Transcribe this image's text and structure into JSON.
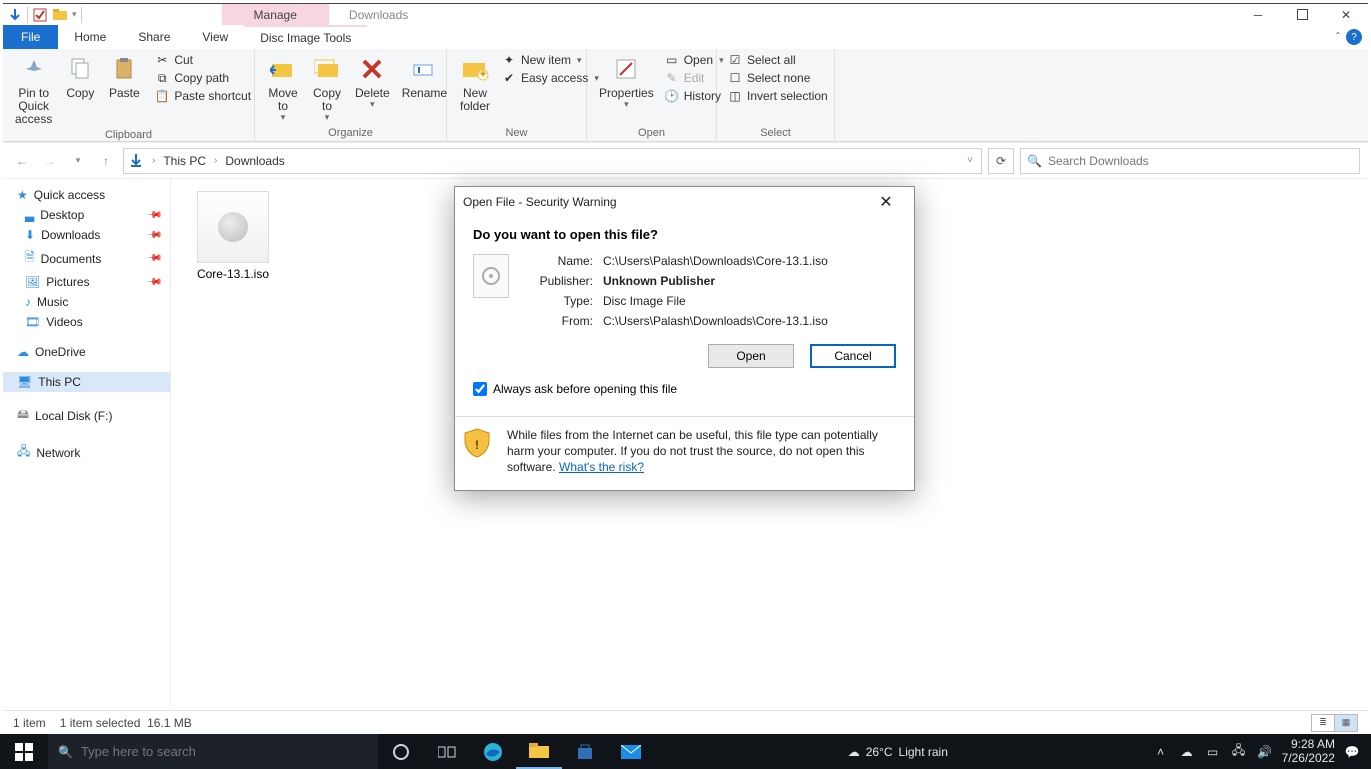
{
  "window": {
    "context_tab": "Manage",
    "title": "Downloads",
    "tabs": {
      "file": "File",
      "home": "Home",
      "share": "Share",
      "view": "View",
      "disc": "Disc Image Tools"
    }
  },
  "ribbon": {
    "clipboard": {
      "label": "Clipboard",
      "pin": "Pin to Quick access",
      "copy": "Copy",
      "paste": "Paste",
      "cut": "Cut",
      "copypath": "Copy path",
      "pasteshortcut": "Paste shortcut"
    },
    "organize": {
      "label": "Organize",
      "moveto": "Move to",
      "copyto": "Copy to",
      "delete": "Delete",
      "rename": "Rename"
    },
    "new": {
      "label": "New",
      "newfolder": "New folder",
      "newitem": "New item",
      "easyaccess": "Easy access"
    },
    "open": {
      "label": "Open",
      "properties": "Properties",
      "open": "Open",
      "edit": "Edit",
      "history": "History"
    },
    "select": {
      "label": "Select",
      "selectall": "Select all",
      "selectnone": "Select none",
      "invert": "Invert selection"
    }
  },
  "breadcrumb": {
    "seg1": "This PC",
    "seg2": "Downloads"
  },
  "search": {
    "placeholder": "Search Downloads"
  },
  "nav": {
    "quick": "Quick access",
    "desktop": "Desktop",
    "downloads": "Downloads",
    "documents": "Documents",
    "pictures": "Pictures",
    "music": "Music",
    "videos": "Videos",
    "onedrive": "OneDrive",
    "thispc": "This PC",
    "localdisk": "Local Disk (F:)",
    "network": "Network"
  },
  "files": {
    "item0": "Core-13.1.iso"
  },
  "status": {
    "count": "1 item",
    "selected": "1 item selected",
    "size": "16.1 MB"
  },
  "dialog": {
    "title": "Open File - Security Warning",
    "question": "Do you want to open this file?",
    "labels": {
      "name": "Name:",
      "publisher": "Publisher:",
      "type": "Type:",
      "from": "From:"
    },
    "values": {
      "name": "C:\\Users\\Palash\\Downloads\\Core-13.1.iso",
      "publisher": "Unknown Publisher",
      "type": "Disc Image File",
      "from": "C:\\Users\\Palash\\Downloads\\Core-13.1.iso"
    },
    "open": "Open",
    "cancel": "Cancel",
    "always": "Always ask before opening this file",
    "warn": "While files from the Internet can be useful, this file type can potentially harm your computer. If you do not trust the source, do not open this software. ",
    "risk": "What's the risk?"
  },
  "taskbar": {
    "search_placeholder": "Type here to search",
    "weather_temp": "26°C",
    "weather_cond": "Light rain",
    "time": "9:28 AM",
    "date": "7/26/2022"
  }
}
